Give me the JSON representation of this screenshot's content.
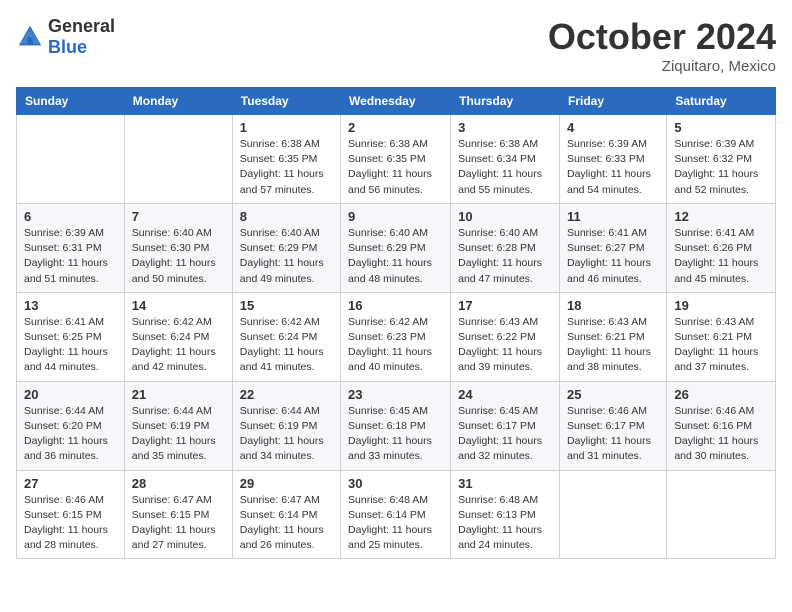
{
  "logo": {
    "general": "General",
    "blue": "Blue"
  },
  "header": {
    "month": "October 2024",
    "location": "Ziquitaro, Mexico"
  },
  "columns": [
    "Sunday",
    "Monday",
    "Tuesday",
    "Wednesday",
    "Thursday",
    "Friday",
    "Saturday"
  ],
  "weeks": [
    [
      {
        "day": "",
        "sunrise": "",
        "sunset": "",
        "daylight": ""
      },
      {
        "day": "",
        "sunrise": "",
        "sunset": "",
        "daylight": ""
      },
      {
        "day": "1",
        "sunrise": "Sunrise: 6:38 AM",
        "sunset": "Sunset: 6:35 PM",
        "daylight": "Daylight: 11 hours and 57 minutes."
      },
      {
        "day": "2",
        "sunrise": "Sunrise: 6:38 AM",
        "sunset": "Sunset: 6:35 PM",
        "daylight": "Daylight: 11 hours and 56 minutes."
      },
      {
        "day": "3",
        "sunrise": "Sunrise: 6:38 AM",
        "sunset": "Sunset: 6:34 PM",
        "daylight": "Daylight: 11 hours and 55 minutes."
      },
      {
        "day": "4",
        "sunrise": "Sunrise: 6:39 AM",
        "sunset": "Sunset: 6:33 PM",
        "daylight": "Daylight: 11 hours and 54 minutes."
      },
      {
        "day": "5",
        "sunrise": "Sunrise: 6:39 AM",
        "sunset": "Sunset: 6:32 PM",
        "daylight": "Daylight: 11 hours and 52 minutes."
      }
    ],
    [
      {
        "day": "6",
        "sunrise": "Sunrise: 6:39 AM",
        "sunset": "Sunset: 6:31 PM",
        "daylight": "Daylight: 11 hours and 51 minutes."
      },
      {
        "day": "7",
        "sunrise": "Sunrise: 6:40 AM",
        "sunset": "Sunset: 6:30 PM",
        "daylight": "Daylight: 11 hours and 50 minutes."
      },
      {
        "day": "8",
        "sunrise": "Sunrise: 6:40 AM",
        "sunset": "Sunset: 6:29 PM",
        "daylight": "Daylight: 11 hours and 49 minutes."
      },
      {
        "day": "9",
        "sunrise": "Sunrise: 6:40 AM",
        "sunset": "Sunset: 6:29 PM",
        "daylight": "Daylight: 11 hours and 48 minutes."
      },
      {
        "day": "10",
        "sunrise": "Sunrise: 6:40 AM",
        "sunset": "Sunset: 6:28 PM",
        "daylight": "Daylight: 11 hours and 47 minutes."
      },
      {
        "day": "11",
        "sunrise": "Sunrise: 6:41 AM",
        "sunset": "Sunset: 6:27 PM",
        "daylight": "Daylight: 11 hours and 46 minutes."
      },
      {
        "day": "12",
        "sunrise": "Sunrise: 6:41 AM",
        "sunset": "Sunset: 6:26 PM",
        "daylight": "Daylight: 11 hours and 45 minutes."
      }
    ],
    [
      {
        "day": "13",
        "sunrise": "Sunrise: 6:41 AM",
        "sunset": "Sunset: 6:25 PM",
        "daylight": "Daylight: 11 hours and 44 minutes."
      },
      {
        "day": "14",
        "sunrise": "Sunrise: 6:42 AM",
        "sunset": "Sunset: 6:24 PM",
        "daylight": "Daylight: 11 hours and 42 minutes."
      },
      {
        "day": "15",
        "sunrise": "Sunrise: 6:42 AM",
        "sunset": "Sunset: 6:24 PM",
        "daylight": "Daylight: 11 hours and 41 minutes."
      },
      {
        "day": "16",
        "sunrise": "Sunrise: 6:42 AM",
        "sunset": "Sunset: 6:23 PM",
        "daylight": "Daylight: 11 hours and 40 minutes."
      },
      {
        "day": "17",
        "sunrise": "Sunrise: 6:43 AM",
        "sunset": "Sunset: 6:22 PM",
        "daylight": "Daylight: 11 hours and 39 minutes."
      },
      {
        "day": "18",
        "sunrise": "Sunrise: 6:43 AM",
        "sunset": "Sunset: 6:21 PM",
        "daylight": "Daylight: 11 hours and 38 minutes."
      },
      {
        "day": "19",
        "sunrise": "Sunrise: 6:43 AM",
        "sunset": "Sunset: 6:21 PM",
        "daylight": "Daylight: 11 hours and 37 minutes."
      }
    ],
    [
      {
        "day": "20",
        "sunrise": "Sunrise: 6:44 AM",
        "sunset": "Sunset: 6:20 PM",
        "daylight": "Daylight: 11 hours and 36 minutes."
      },
      {
        "day": "21",
        "sunrise": "Sunrise: 6:44 AM",
        "sunset": "Sunset: 6:19 PM",
        "daylight": "Daylight: 11 hours and 35 minutes."
      },
      {
        "day": "22",
        "sunrise": "Sunrise: 6:44 AM",
        "sunset": "Sunset: 6:19 PM",
        "daylight": "Daylight: 11 hours and 34 minutes."
      },
      {
        "day": "23",
        "sunrise": "Sunrise: 6:45 AM",
        "sunset": "Sunset: 6:18 PM",
        "daylight": "Daylight: 11 hours and 33 minutes."
      },
      {
        "day": "24",
        "sunrise": "Sunrise: 6:45 AM",
        "sunset": "Sunset: 6:17 PM",
        "daylight": "Daylight: 11 hours and 32 minutes."
      },
      {
        "day": "25",
        "sunrise": "Sunrise: 6:46 AM",
        "sunset": "Sunset: 6:17 PM",
        "daylight": "Daylight: 11 hours and 31 minutes."
      },
      {
        "day": "26",
        "sunrise": "Sunrise: 6:46 AM",
        "sunset": "Sunset: 6:16 PM",
        "daylight": "Daylight: 11 hours and 30 minutes."
      }
    ],
    [
      {
        "day": "27",
        "sunrise": "Sunrise: 6:46 AM",
        "sunset": "Sunset: 6:15 PM",
        "daylight": "Daylight: 11 hours and 28 minutes."
      },
      {
        "day": "28",
        "sunrise": "Sunrise: 6:47 AM",
        "sunset": "Sunset: 6:15 PM",
        "daylight": "Daylight: 11 hours and 27 minutes."
      },
      {
        "day": "29",
        "sunrise": "Sunrise: 6:47 AM",
        "sunset": "Sunset: 6:14 PM",
        "daylight": "Daylight: 11 hours and 26 minutes."
      },
      {
        "day": "30",
        "sunrise": "Sunrise: 6:48 AM",
        "sunset": "Sunset: 6:14 PM",
        "daylight": "Daylight: 11 hours and 25 minutes."
      },
      {
        "day": "31",
        "sunrise": "Sunrise: 6:48 AM",
        "sunset": "Sunset: 6:13 PM",
        "daylight": "Daylight: 11 hours and 24 minutes."
      },
      {
        "day": "",
        "sunrise": "",
        "sunset": "",
        "daylight": ""
      },
      {
        "day": "",
        "sunrise": "",
        "sunset": "",
        "daylight": ""
      }
    ]
  ]
}
